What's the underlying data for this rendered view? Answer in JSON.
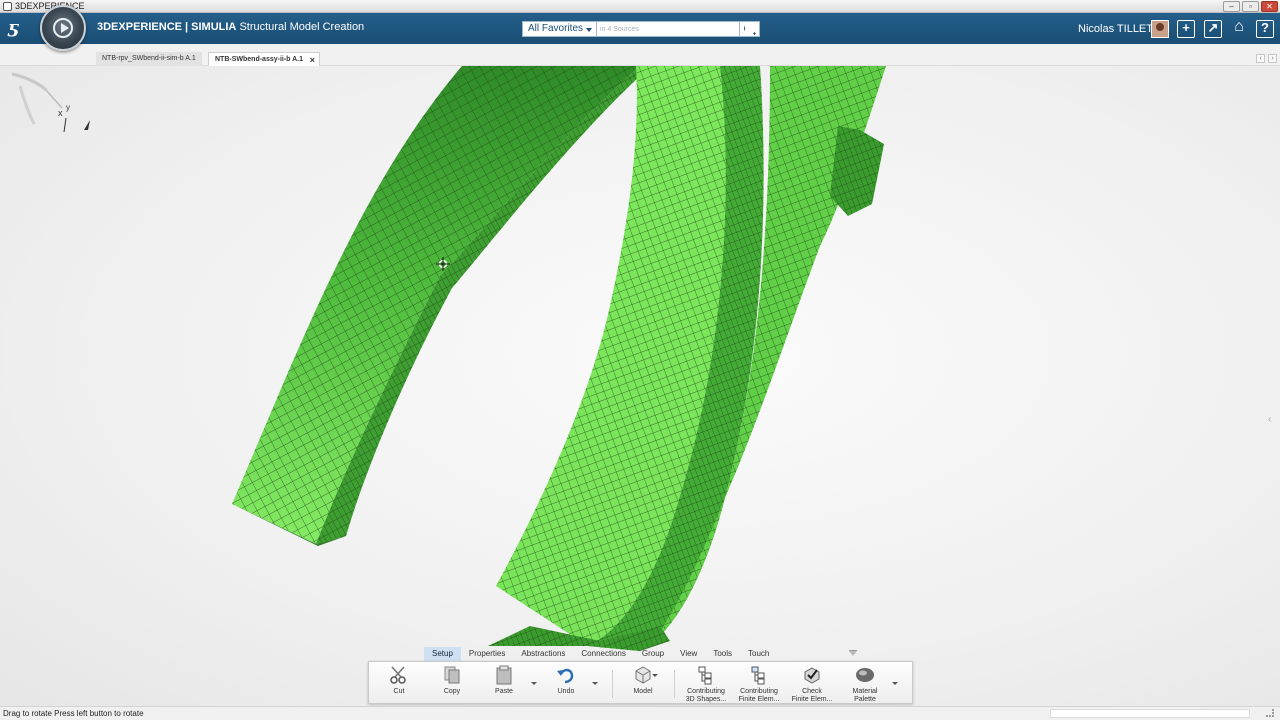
{
  "window": {
    "title": "3DEXPERIENCE",
    "controls": [
      "–",
      "▫",
      "✕"
    ]
  },
  "header": {
    "brand": "3DEXPERIENCE | SIMULIA",
    "app_name": "Structural Model Creation",
    "search": {
      "scope": "All Favorites",
      "placeholder": "in 4 Sources"
    },
    "user": "Nicolas TILLET"
  },
  "tabs": [
    {
      "label": "NTB-rpv_SWbend-ii-sim-b A.1",
      "active": false
    },
    {
      "label": "NTB-SWbend-assy-ii-b A.1",
      "active": true
    }
  ],
  "action_tabs": [
    "Setup",
    "Properties",
    "Abstractions",
    "Connections",
    "Group",
    "View",
    "Tools",
    "Touch"
  ],
  "active_action_tab": "Setup",
  "actions": [
    {
      "id": "cut",
      "label": "Cut",
      "icon": "scissors-icon"
    },
    {
      "id": "copy",
      "label": "Copy",
      "icon": "copy-icon"
    },
    {
      "id": "paste",
      "label": "Paste",
      "icon": "paste-icon"
    },
    {
      "id": "undo",
      "label": "Undo",
      "icon": "undo-icon"
    },
    {
      "id": "model",
      "label": "Model",
      "icon": "model-icon"
    },
    {
      "id": "contrib_shapes",
      "label_line1": "Contributing",
      "label_line2": "3D Shapes...",
      "icon": "contributing-shapes-icon"
    },
    {
      "id": "contrib_fe",
      "label_line1": "Contributing",
      "label_line2": "Finite Elem...",
      "icon": "contributing-finite-elements-icon"
    },
    {
      "id": "check_fe",
      "label_line1": "Check",
      "label_line2": "Finite Elem...",
      "icon": "check-finite-elements-icon"
    },
    {
      "id": "material",
      "label_line1": "Material",
      "label_line2": "Palette",
      "icon": "material-palette-icon"
    }
  ],
  "status": {
    "text": "Drag to rotate  Press left button to rotate"
  },
  "colors": {
    "header": "#1f5780",
    "mesh_light": "#7be35a",
    "mesh_dark": "#2c8a26",
    "mesh_line": "#1d4d14"
  }
}
